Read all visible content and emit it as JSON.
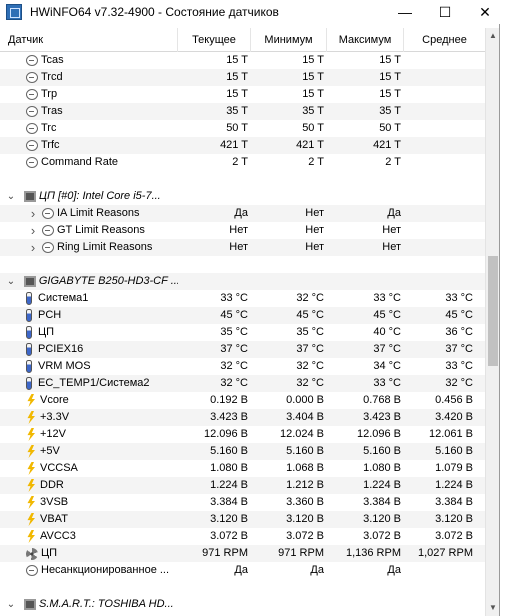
{
  "window": {
    "title": "HWiNFO64 v7.32-4900 - Состояние датчиков",
    "minimize_glyph": "—",
    "maximize_glyph": "☐",
    "close_glyph": "✕"
  },
  "columns": [
    "Датчик",
    "Текущее",
    "Минимум",
    "Максимум",
    "Среднее"
  ],
  "rows": [
    {
      "kind": "sensor",
      "icon": "clock-icon",
      "label": "Tcas",
      "cur": "15 T",
      "min": "15 T",
      "max": "15 T",
      "avg": ""
    },
    {
      "kind": "sensor",
      "icon": "clock-icon",
      "label": "Trcd",
      "cur": "15 T",
      "min": "15 T",
      "max": "15 T",
      "avg": ""
    },
    {
      "kind": "sensor",
      "icon": "clock-icon",
      "label": "Trp",
      "cur": "15 T",
      "min": "15 T",
      "max": "15 T",
      "avg": ""
    },
    {
      "kind": "sensor",
      "icon": "clock-icon",
      "label": "Tras",
      "cur": "35 T",
      "min": "35 T",
      "max": "35 T",
      "avg": ""
    },
    {
      "kind": "sensor",
      "icon": "clock-icon",
      "label": "Trc",
      "cur": "50 T",
      "min": "50 T",
      "max": "50 T",
      "avg": ""
    },
    {
      "kind": "sensor",
      "icon": "clock-icon",
      "label": "Trfc",
      "cur": "421 T",
      "min": "421 T",
      "max": "421 T",
      "avg": ""
    },
    {
      "kind": "sensor",
      "icon": "clock-icon",
      "label": "Command Rate",
      "cur": "2 T",
      "min": "2 T",
      "max": "2 T",
      "avg": ""
    },
    {
      "kind": "spacer"
    },
    {
      "kind": "group",
      "label": "ЦП [#0]: Intel Core i5-7..."
    },
    {
      "kind": "expandable",
      "icon": "clock-icon",
      "label": "IA Limit Reasons",
      "cur": "Да",
      "min": "Нет",
      "max": "Да",
      "avg": ""
    },
    {
      "kind": "expandable",
      "icon": "clock-icon",
      "label": "GT Limit Reasons",
      "cur": "Нет",
      "min": "Нет",
      "max": "Нет",
      "avg": ""
    },
    {
      "kind": "expandable",
      "icon": "clock-icon",
      "label": "Ring Limit Reasons",
      "cur": "Нет",
      "min": "Нет",
      "max": "Нет",
      "avg": ""
    },
    {
      "kind": "spacer"
    },
    {
      "kind": "group",
      "label": "GIGABYTE B250-HD3-CF ..."
    },
    {
      "kind": "sensor",
      "icon": "thermometer-icon",
      "label": "Система1",
      "cur": "33 °C",
      "min": "32 °C",
      "max": "33 °C",
      "avg": "33 °C"
    },
    {
      "kind": "sensor",
      "icon": "thermometer-icon",
      "label": "PCH",
      "cur": "45 °C",
      "min": "45 °C",
      "max": "45 °C",
      "avg": "45 °C"
    },
    {
      "kind": "sensor",
      "icon": "thermometer-icon",
      "label": "ЦП",
      "cur": "35 °C",
      "min": "35 °C",
      "max": "40 °C",
      "avg": "36 °C"
    },
    {
      "kind": "sensor",
      "icon": "thermometer-icon",
      "label": "PCIEX16",
      "cur": "37 °C",
      "min": "37 °C",
      "max": "37 °C",
      "avg": "37 °C"
    },
    {
      "kind": "sensor",
      "icon": "thermometer-icon",
      "label": "VRM MOS",
      "cur": "32 °C",
      "min": "32 °C",
      "max": "34 °C",
      "avg": "33 °C"
    },
    {
      "kind": "sensor",
      "icon": "thermometer-icon",
      "label": "EC_TEMP1/Система2",
      "cur": "32 °C",
      "min": "32 °C",
      "max": "33 °C",
      "avg": "32 °C"
    },
    {
      "kind": "sensor",
      "icon": "lightning-icon",
      "label": "Vcore",
      "cur": "0.192 В",
      "min": "0.000 В",
      "max": "0.768 В",
      "avg": "0.456 В"
    },
    {
      "kind": "sensor",
      "icon": "lightning-icon",
      "label": "+3.3V",
      "cur": "3.423 В",
      "min": "3.404 В",
      "max": "3.423 В",
      "avg": "3.420 В"
    },
    {
      "kind": "sensor",
      "icon": "lightning-icon",
      "label": "+12V",
      "cur": "12.096 В",
      "min": "12.024 В",
      "max": "12.096 В",
      "avg": "12.061 В"
    },
    {
      "kind": "sensor",
      "icon": "lightning-icon",
      "label": "+5V",
      "cur": "5.160 В",
      "min": "5.160 В",
      "max": "5.160 В",
      "avg": "5.160 В"
    },
    {
      "kind": "sensor",
      "icon": "lightning-icon",
      "label": "VCCSA",
      "cur": "1.080 В",
      "min": "1.068 В",
      "max": "1.080 В",
      "avg": "1.079 В"
    },
    {
      "kind": "sensor",
      "icon": "lightning-icon",
      "label": "DDR",
      "cur": "1.224 В",
      "min": "1.212 В",
      "max": "1.224 В",
      "avg": "1.224 В"
    },
    {
      "kind": "sensor",
      "icon": "lightning-icon",
      "label": "3VSB",
      "cur": "3.384 В",
      "min": "3.360 В",
      "max": "3.384 В",
      "avg": "3.384 В"
    },
    {
      "kind": "sensor",
      "icon": "lightning-icon",
      "label": "VBAT",
      "cur": "3.120 В",
      "min": "3.120 В",
      "max": "3.120 В",
      "avg": "3.120 В"
    },
    {
      "kind": "sensor",
      "icon": "lightning-icon",
      "label": "AVCC3",
      "cur": "3.072 В",
      "min": "3.072 В",
      "max": "3.072 В",
      "avg": "3.072 В"
    },
    {
      "kind": "sensor",
      "icon": "fan-icon",
      "label": "ЦП",
      "cur": "971 RPM",
      "min": "971 RPM",
      "max": "1,136 RPM",
      "avg": "1,027 RPM"
    },
    {
      "kind": "sensor",
      "icon": "clock-icon",
      "label": "Несанкционированное ...",
      "cur": "Да",
      "min": "Да",
      "max": "Да",
      "avg": ""
    },
    {
      "kind": "spacer"
    },
    {
      "kind": "group",
      "label": "S.M.A.R.T.: TOSHIBA HD..."
    }
  ],
  "scrollbar": {
    "up_glyph": "▲",
    "down_glyph": "▼"
  }
}
